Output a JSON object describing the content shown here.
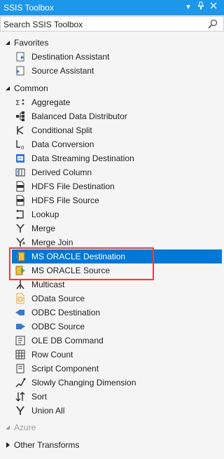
{
  "panel": {
    "title": "SSIS Toolbox",
    "dropdown_icon": "chevron-down-icon",
    "pin_icon": "pin-icon",
    "close_icon": "close-icon"
  },
  "search": {
    "placeholder": "Search SSIS Toolbox",
    "icon": "search-icon"
  },
  "favorites": {
    "label": "Favorites",
    "items": [
      {
        "label": "Destination Assistant"
      },
      {
        "label": "Source Assistant"
      }
    ]
  },
  "common": {
    "label": "Common",
    "items": [
      {
        "label": "Aggregate"
      },
      {
        "label": "Balanced Data Distributor"
      },
      {
        "label": "Conditional Split"
      },
      {
        "label": "Data Conversion"
      },
      {
        "label": "Data Streaming Destination"
      },
      {
        "label": "Derived Column"
      },
      {
        "label": "HDFS File Destination"
      },
      {
        "label": "HDFS File Source"
      },
      {
        "label": "Lookup"
      },
      {
        "label": "Merge"
      },
      {
        "label": "Merge Join"
      },
      {
        "label": "MS ORACLE Destination"
      },
      {
        "label": "MS ORACLE Source"
      },
      {
        "label": "Multicast"
      },
      {
        "label": "OData Source"
      },
      {
        "label": "ODBC Destination"
      },
      {
        "label": "ODBC Source"
      },
      {
        "label": "OLE DB Command"
      },
      {
        "label": "Row Count"
      },
      {
        "label": "Script Component"
      },
      {
        "label": "Slowly Changing Dimension"
      },
      {
        "label": "Sort"
      },
      {
        "label": "Union All"
      }
    ]
  },
  "azure": {
    "label": "Azure"
  },
  "other": {
    "label": "Other Transforms"
  },
  "colors": {
    "selection": "#0078d7",
    "title_bar": "#1c97ea",
    "highlight": "#e34141"
  }
}
